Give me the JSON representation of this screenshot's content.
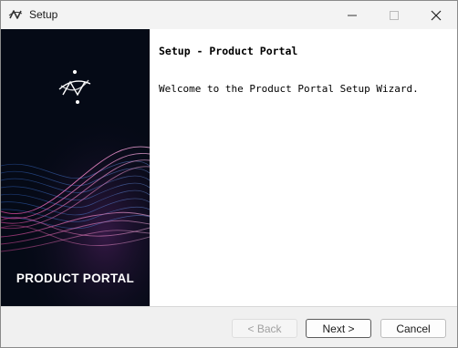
{
  "window": {
    "title": "Setup",
    "minimize_icon": "minimize-icon",
    "maximize_icon": "maximize-icon",
    "close_icon": "close-icon"
  },
  "banner": {
    "brand_text": "PRODUCT PORTAL",
    "logo_icon": "product-portal-logo",
    "colors": {
      "background": "#050a16",
      "wave_pink": "#e46bb0",
      "wave_blue": "#3d6fd0"
    }
  },
  "content": {
    "heading": "Setup - Product Portal",
    "welcome": "Welcome to the Product Portal Setup Wizard."
  },
  "footer": {
    "back_label": "< Back",
    "next_label": "Next >",
    "cancel_label": "Cancel",
    "back_enabled": false
  }
}
